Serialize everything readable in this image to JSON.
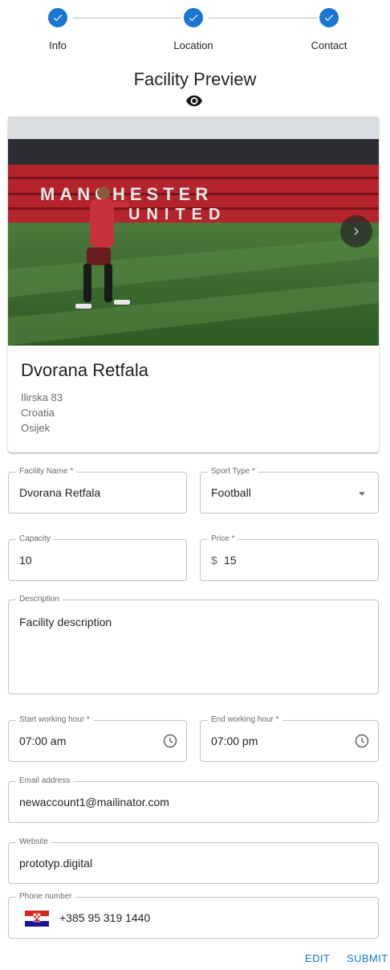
{
  "stepper": {
    "steps": [
      {
        "label": "Info"
      },
      {
        "label": "Location"
      },
      {
        "label": "Contact"
      }
    ]
  },
  "preview": {
    "title": "Facility Preview"
  },
  "card": {
    "title": "Dvorana Retfala",
    "address_lines": [
      "Ilirska 83",
      "Croatia",
      "Osijek"
    ]
  },
  "form": {
    "facility_name": {
      "label": "Facility Name *",
      "value": "Dvorana Retfala"
    },
    "sport_type": {
      "label": "Sport Type *",
      "value": "Football"
    },
    "capacity": {
      "label": "Capacity",
      "value": "10"
    },
    "price": {
      "label": "Price *",
      "currency": "$",
      "value": "15"
    },
    "description": {
      "label": "Description",
      "value": "Facility description"
    },
    "start_hour": {
      "label": "Start working hour *",
      "value": "07:00 am"
    },
    "end_hour": {
      "label": "End working hour *",
      "value": "07:00 pm"
    },
    "email": {
      "label": "Email address",
      "value": "newaccount1@mailinator.com"
    },
    "website": {
      "label": "Website",
      "value": "prototyp.digital"
    },
    "phone": {
      "label": "Phone number",
      "value": "+385 95 319 1440",
      "flag": "croatia-flag"
    }
  },
  "actions": {
    "edit_label": "EDIT",
    "submit_label": "SUBMIT"
  },
  "colors": {
    "primary": "#1976d2",
    "outline": "#c4c4c4"
  },
  "icons": {
    "step_done": "check-circle-icon",
    "preview": "eye-icon",
    "carousel_next": "chevron-right-icon",
    "select": "arrow-drop-down-icon",
    "time": "clock-icon"
  }
}
